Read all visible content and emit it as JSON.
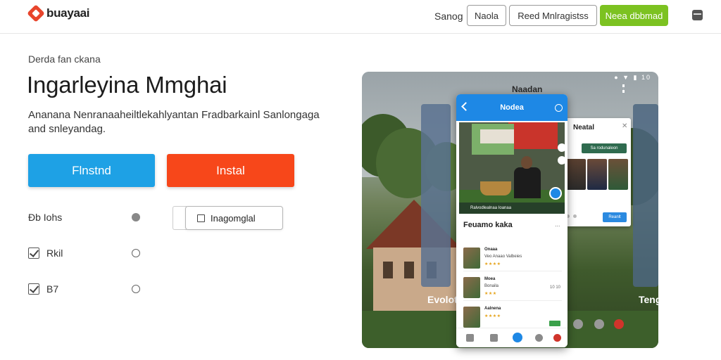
{
  "header": {
    "brand": "buayaai",
    "nav_link": "Sanog",
    "btn_1": "Naola",
    "btn_2": "Reed Mnlragistss",
    "btn_primary": "Neea dbbmad"
  },
  "hero": {
    "eyebrow": "Derda fan ckana",
    "title": "Ingarleyina Mmghai",
    "subtitle": "Ananana Nenranaaheiltlekahlyantan Fradbarkainl Sanlongaga and snleyandag.",
    "cta_primary": "Flnstnd",
    "cta_secondary": "Instal"
  },
  "options": [
    {
      "label": "Đb Iohs",
      "checked": false
    },
    {
      "label": "Rkil",
      "checked": true
    },
    {
      "label": "B7",
      "checked": true
    }
  ],
  "select": {
    "label": "Inagomglal"
  },
  "preview": {
    "status_icons": "● ▼ ▮ 10",
    "photo_title": "Naadan",
    "left_caption": "Evolot",
    "right_caption": "Teng",
    "popup": {
      "title": "Neatal",
      "tag": "Sa rodunaleon",
      "button": "Reanlt"
    },
    "phone": {
      "appbar_title": "Nodea",
      "image_caption": "Ralvodlealnaa Ioanaa",
      "section_title": "Feuamo kaka",
      "section_more": "...",
      "items": [
        {
          "title": "Onaaa",
          "sub": "Veo Anaao Valbeies",
          "stars": "★★★★",
          "right": ""
        },
        {
          "title": "Moea",
          "sub": "Bonaila",
          "stars": "★★★",
          "right": "10 10"
        },
        {
          "title": "Aalnena",
          "sub": "",
          "stars": "★★★★",
          "right": ""
        }
      ]
    }
  },
  "colors": {
    "brand": "#e8452c",
    "cta_blue": "#1ea1e5",
    "cta_red": "#f7471a",
    "primary_green": "#7cc221",
    "app_blue": "#1e88e5"
  }
}
